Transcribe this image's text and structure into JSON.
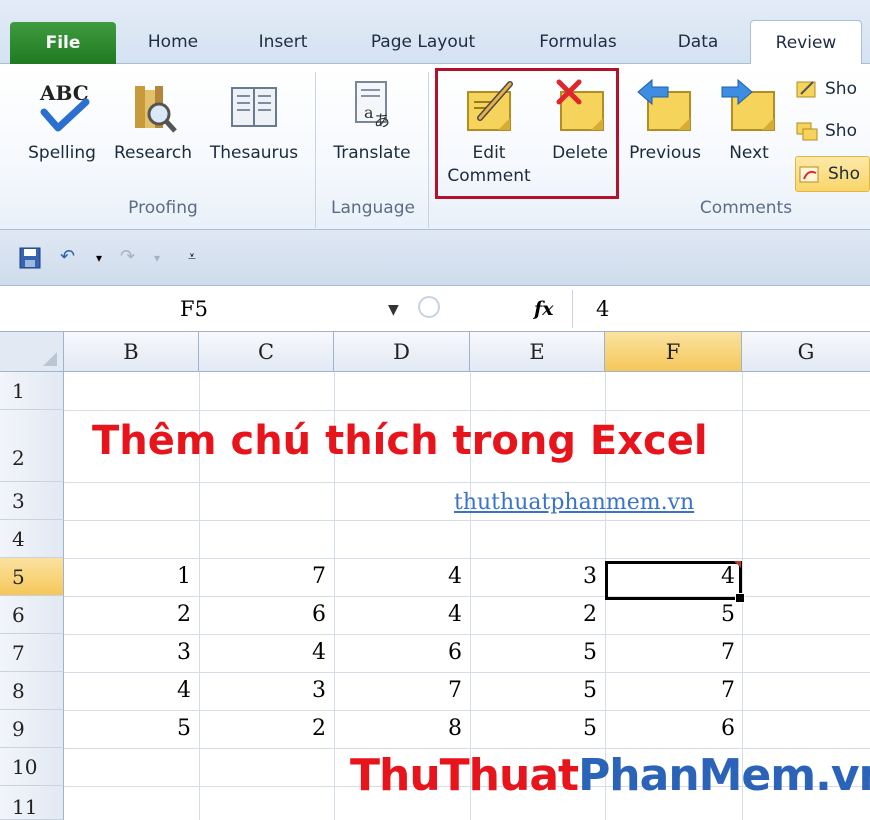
{
  "ribbon_tabs": [
    "File",
    "Home",
    "Insert",
    "Page Layout",
    "Formulas",
    "Data",
    "Review"
  ],
  "active_tab": "Review",
  "ribbon": {
    "proofing": {
      "spelling": "Spelling",
      "research": "Research",
      "thesaurus": "Thesaurus",
      "group": "Proofing"
    },
    "language": {
      "translate": "Translate",
      "group": "Language"
    },
    "comments": {
      "edit_line1": "Edit",
      "edit_line2": "Comment",
      "delete": "Delete",
      "previous": "Previous",
      "next": "Next",
      "show1": "Sho",
      "show2": "Sho",
      "show3": "Sho",
      "group": "Comments"
    }
  },
  "formula_bar": {
    "name_box": "F5",
    "fx": "fx",
    "value": "4"
  },
  "columns": [
    "B",
    "C",
    "D",
    "E",
    "F",
    "G"
  ],
  "rows": [
    "1",
    "2",
    "3",
    "4",
    "5",
    "6",
    "7",
    "8",
    "9",
    "10",
    "11"
  ],
  "selected_cell": "F5",
  "sheet": {
    "title": "Thêm chú thích trong Excel",
    "link": "thuthuatphanmem.vn",
    "table": [
      [
        "1",
        "7",
        "4",
        "3",
        "4"
      ],
      [
        "2",
        "6",
        "4",
        "2",
        "5"
      ],
      [
        "3",
        "4",
        "6",
        "5",
        "7"
      ],
      [
        "4",
        "3",
        "7",
        "5",
        "7"
      ],
      [
        "5",
        "2",
        "8",
        "5",
        "6"
      ]
    ]
  },
  "watermark": {
    "part1": "ThuThuat",
    "part2": "PhanMem.vn"
  },
  "colors": {
    "accent_highlight": "#b2132a",
    "title_red": "#e8141c",
    "watermark_blue": "#2a63b8",
    "file_tab_green": "#1f7a22"
  }
}
